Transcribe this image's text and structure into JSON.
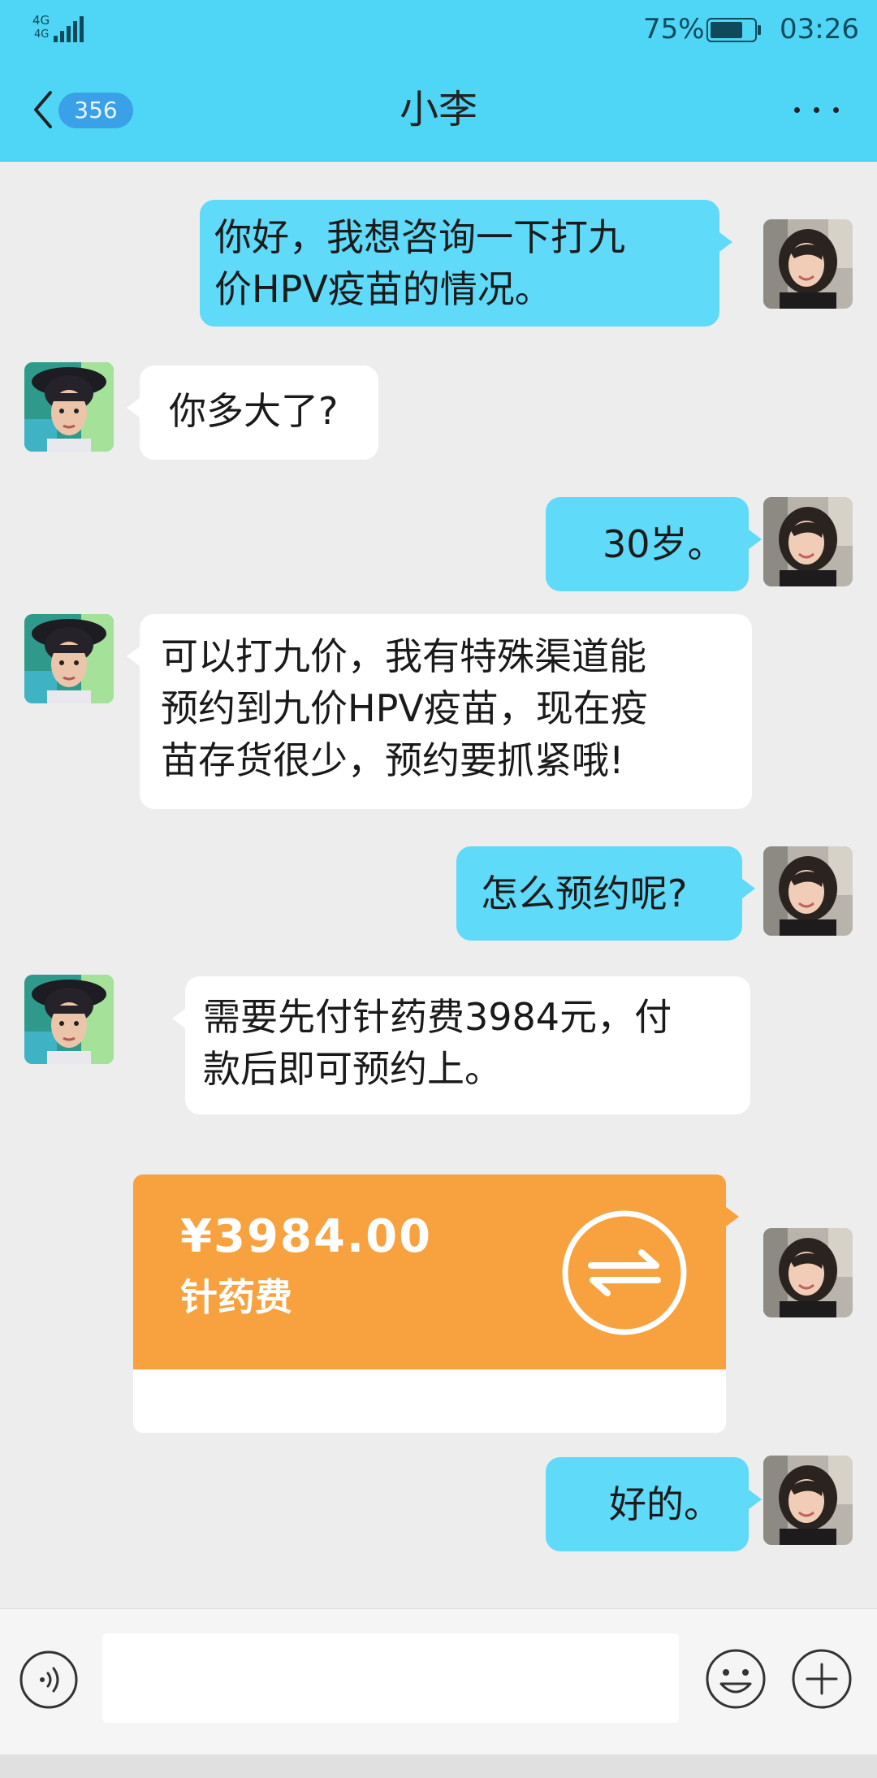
{
  "status_bar": {
    "network": "4G",
    "network_sub": "4G",
    "battery_percent": "75%",
    "battery_level": 0.75,
    "time": "03:26"
  },
  "nav": {
    "back_icon": "chevron-left-icon",
    "unread_count": "356",
    "title": "小李",
    "more_icon": "more-dots-icon"
  },
  "messages": [
    {
      "side": "sent",
      "text_lines": [
        "你好，我想咨询一下打九",
        "价HPV疫苗的情况。"
      ]
    },
    {
      "side": "received",
      "text_lines": [
        "你多大了?"
      ]
    },
    {
      "side": "sent",
      "text_lines": [
        "30岁。"
      ]
    },
    {
      "side": "received",
      "text_lines": [
        "可以打九价，我有特殊渠道能",
        "预约到九价HPV疫苗，现在疫",
        "苗存货很少，预约要抓紧哦!"
      ]
    },
    {
      "side": "sent",
      "text_lines": [
        "怎么预约呢?"
      ]
    },
    {
      "side": "received",
      "text_lines": [
        "需要先付针药费3984元，付",
        "款后即可预约上。"
      ]
    },
    {
      "side": "sent",
      "type": "transfer",
      "amount": "¥3984.00",
      "note": "针药费",
      "icon": "transfer-arrows-icon"
    },
    {
      "side": "sent",
      "text_lines": [
        "好的。"
      ]
    }
  ],
  "input_bar": {
    "voice_icon": "voice-icon",
    "emoji_icon": "emoji-icon",
    "plus_icon": "plus-icon",
    "placeholder": ""
  },
  "colors": {
    "header": "#4fd6f6",
    "sent_bubble": "#5fdaf8",
    "received_bubble": "#ffffff",
    "transfer_card": "#f7a13f",
    "background": "#ededed"
  }
}
